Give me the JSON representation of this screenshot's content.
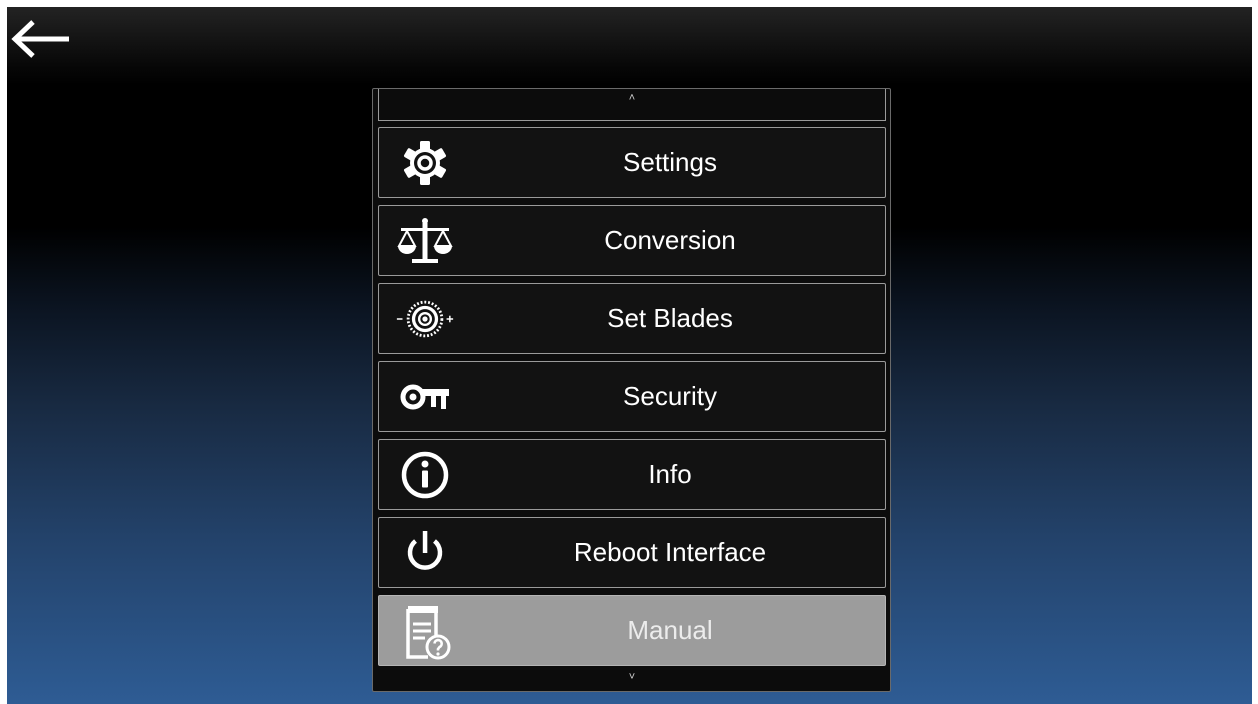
{
  "nav": {
    "back_icon": "left-arrow-icon"
  },
  "menu": {
    "scroll_up_glyph": "˄",
    "scroll_down_glyph": "˅",
    "items": [
      {
        "label": "Settings",
        "icon": "gear-icon"
      },
      {
        "label": "Conversion",
        "icon": "scale-icon"
      },
      {
        "label": "Set Blades",
        "icon": "blade-adjust-icon"
      },
      {
        "label": "Security",
        "icon": "key-icon"
      },
      {
        "label": "Info",
        "icon": "info-icon"
      },
      {
        "label": "Reboot Interface",
        "icon": "power-icon"
      },
      {
        "label": "Manual",
        "icon": "manual-icon",
        "selected": true
      }
    ]
  },
  "colors": {
    "selected_item_bg": "#9c9c9c",
    "item_bg": "#121212",
    "item_border": "#9a9a9a",
    "text": "#ffffff"
  }
}
